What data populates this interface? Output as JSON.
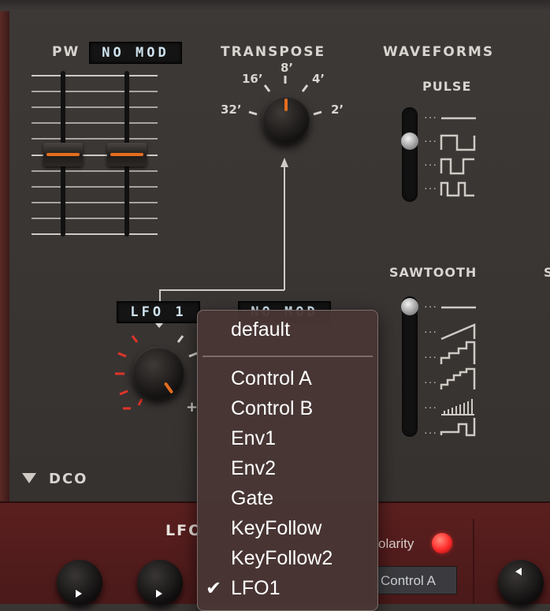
{
  "dco": {
    "pw_label": "PW",
    "pw_mod": "NO MOD",
    "transpose_label": "TRANSPOSE",
    "transpose_marks": [
      "32’",
      "16’",
      "8’",
      "4’",
      "2’"
    ],
    "waveforms_label": "WAVEFORMS",
    "pulse_label": "PULSE",
    "sawtooth_label": "SAWTOOTH",
    "sawtooth_label_cut": "S",
    "lfo_source": "LFO 1",
    "mod_source_2": "NO MOD",
    "knob_plus": "+",
    "section_label": "DCO",
    "pulse_level": 0.3333,
    "sawtooth_level": 0.0
  },
  "lfo_panel": {
    "label": "LFO",
    "polarity_label": "olarity",
    "control_select": "Control A"
  },
  "dropdown": {
    "items": [
      "default",
      "Control A",
      "Control B",
      "Env1",
      "Env2",
      "Gate",
      "KeyFollow",
      "KeyFollow2",
      "LFO1"
    ],
    "selected": "LFO1",
    "checkmark": "✔"
  },
  "colors": {
    "accent_orange": "#e46d1e",
    "panel_dark": "#3a3634",
    "bottom_red": "#5b1f1f",
    "led_red": "#ff2a2a"
  }
}
